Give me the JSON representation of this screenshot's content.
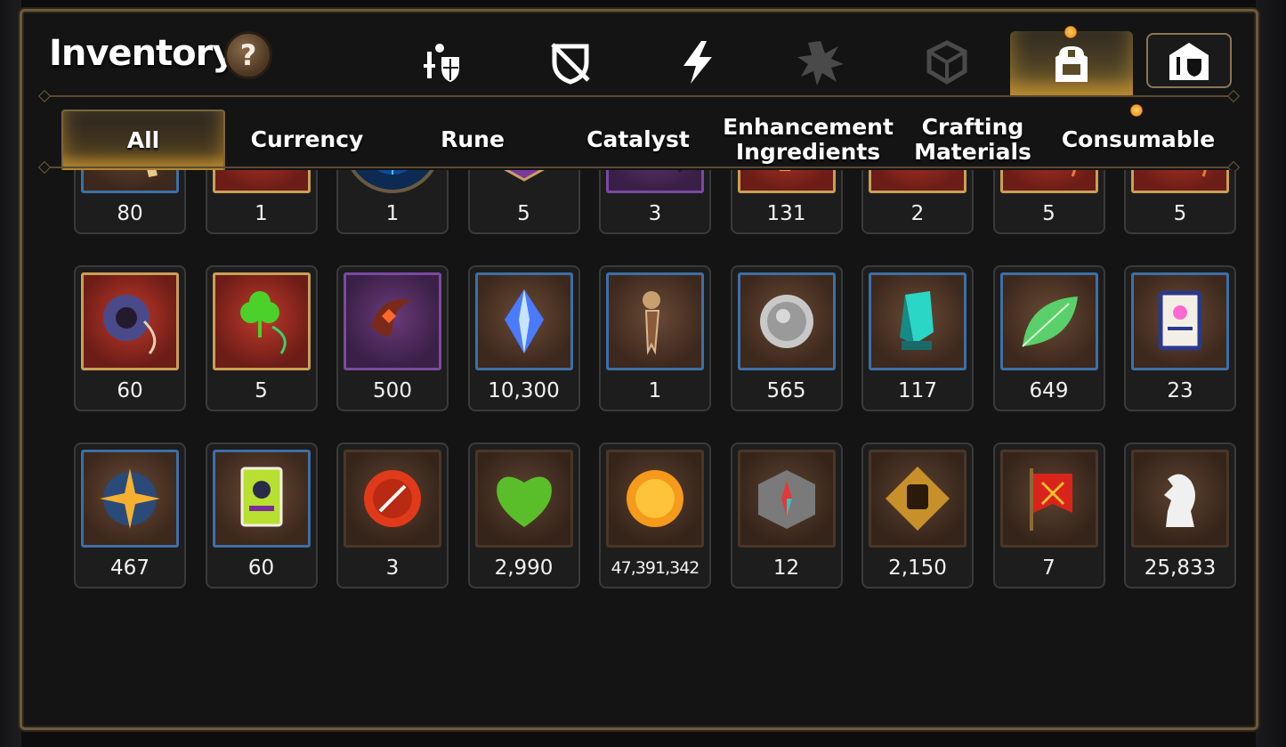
{
  "header": {
    "title": "Inventory",
    "help_label": "?"
  },
  "category_tabs": [
    {
      "icon": "hero-equip-icon"
    },
    {
      "icon": "broken-shield-icon"
    },
    {
      "icon": "lightning-icon"
    },
    {
      "icon": "explosion-icon"
    },
    {
      "icon": "cube-icon"
    },
    {
      "icon": "backpack-icon",
      "active": true
    },
    {
      "icon": "guild-shield-icon"
    }
  ],
  "filters": [
    {
      "label": "All",
      "active": true
    },
    {
      "label": "Currency"
    },
    {
      "label": "Rune"
    },
    {
      "label": "Catalyst"
    },
    {
      "label": "Enhancement\nIngredients"
    },
    {
      "label": "Crafting\nMaterials"
    },
    {
      "label": "Consumable"
    }
  ],
  "rows": [
    [
      {
        "icon": "ginseng-root-icon",
        "frame": "blue",
        "qty": "80"
      },
      {
        "icon": "green-orb-icon",
        "frame": "red",
        "qty": "1"
      },
      {
        "icon": "blue-rune-disc-icon",
        "frame": "round",
        "qty": "1"
      },
      {
        "icon": "pet-food-bag-icon",
        "frame": "hex",
        "qty": "5"
      },
      {
        "icon": "feather-wand-icon",
        "frame": "purple",
        "qty": "3"
      },
      {
        "icon": "fire-crystal-icon",
        "frame": "red",
        "qty": "131"
      },
      {
        "icon": "triquetra-crystal-icon",
        "frame": "red",
        "qty": "2"
      },
      {
        "icon": "flame-necklace-icon",
        "frame": "red",
        "qty": "5"
      },
      {
        "icon": "water-drop-necklace-icon",
        "frame": "red",
        "qty": "5"
      }
    ],
    [
      {
        "icon": "ring-necklace-icon",
        "frame": "red",
        "qty": "60"
      },
      {
        "icon": "clover-necklace-icon",
        "frame": "red",
        "qty": "5"
      },
      {
        "icon": "crescent-charm-icon",
        "frame": "purple",
        "qty": "500"
      },
      {
        "icon": "blue-crystal-icon",
        "frame": "blue",
        "qty": "10,300"
      },
      {
        "icon": "bookmark-dagger-icon",
        "frame": "blue",
        "qty": "1"
      },
      {
        "icon": "silver-coin-icon",
        "frame": "blue",
        "qty": "565"
      },
      {
        "icon": "teal-crystal-icon",
        "frame": "blue",
        "qty": "117"
      },
      {
        "icon": "leaf-icon",
        "frame": "blue",
        "qty": "649"
      },
      {
        "icon": "ticket-card-icon",
        "frame": "blue",
        "qty": "23"
      }
    ],
    [
      {
        "icon": "star-compass-icon",
        "frame": "blue",
        "qty": "467"
      },
      {
        "icon": "green-card-icon",
        "frame": "blue",
        "qty": "60"
      },
      {
        "icon": "red-badge-icon",
        "frame": "brown",
        "qty": "3"
      },
      {
        "icon": "green-heart-icon",
        "frame": "brown",
        "qty": "2,990"
      },
      {
        "icon": "gold-coin-icon",
        "frame": "brown",
        "qty": "47,391,342"
      },
      {
        "icon": "stone-compass-icon",
        "frame": "brown",
        "qty": "12"
      },
      {
        "icon": "fist-emblem-icon",
        "frame": "brown",
        "qty": "2,150"
      },
      {
        "icon": "war-banner-icon",
        "frame": "brown",
        "qty": "7"
      },
      {
        "icon": "chess-knight-icon",
        "frame": "brown",
        "qty": "25,833"
      }
    ]
  ],
  "colors": {
    "panel_border": "#6d5a3c",
    "active_glow": "#ffbe3c",
    "frame_blue": "#3f6fa5",
    "frame_gold": "#c9a056",
    "frame_purple": "#7a4aa0"
  }
}
